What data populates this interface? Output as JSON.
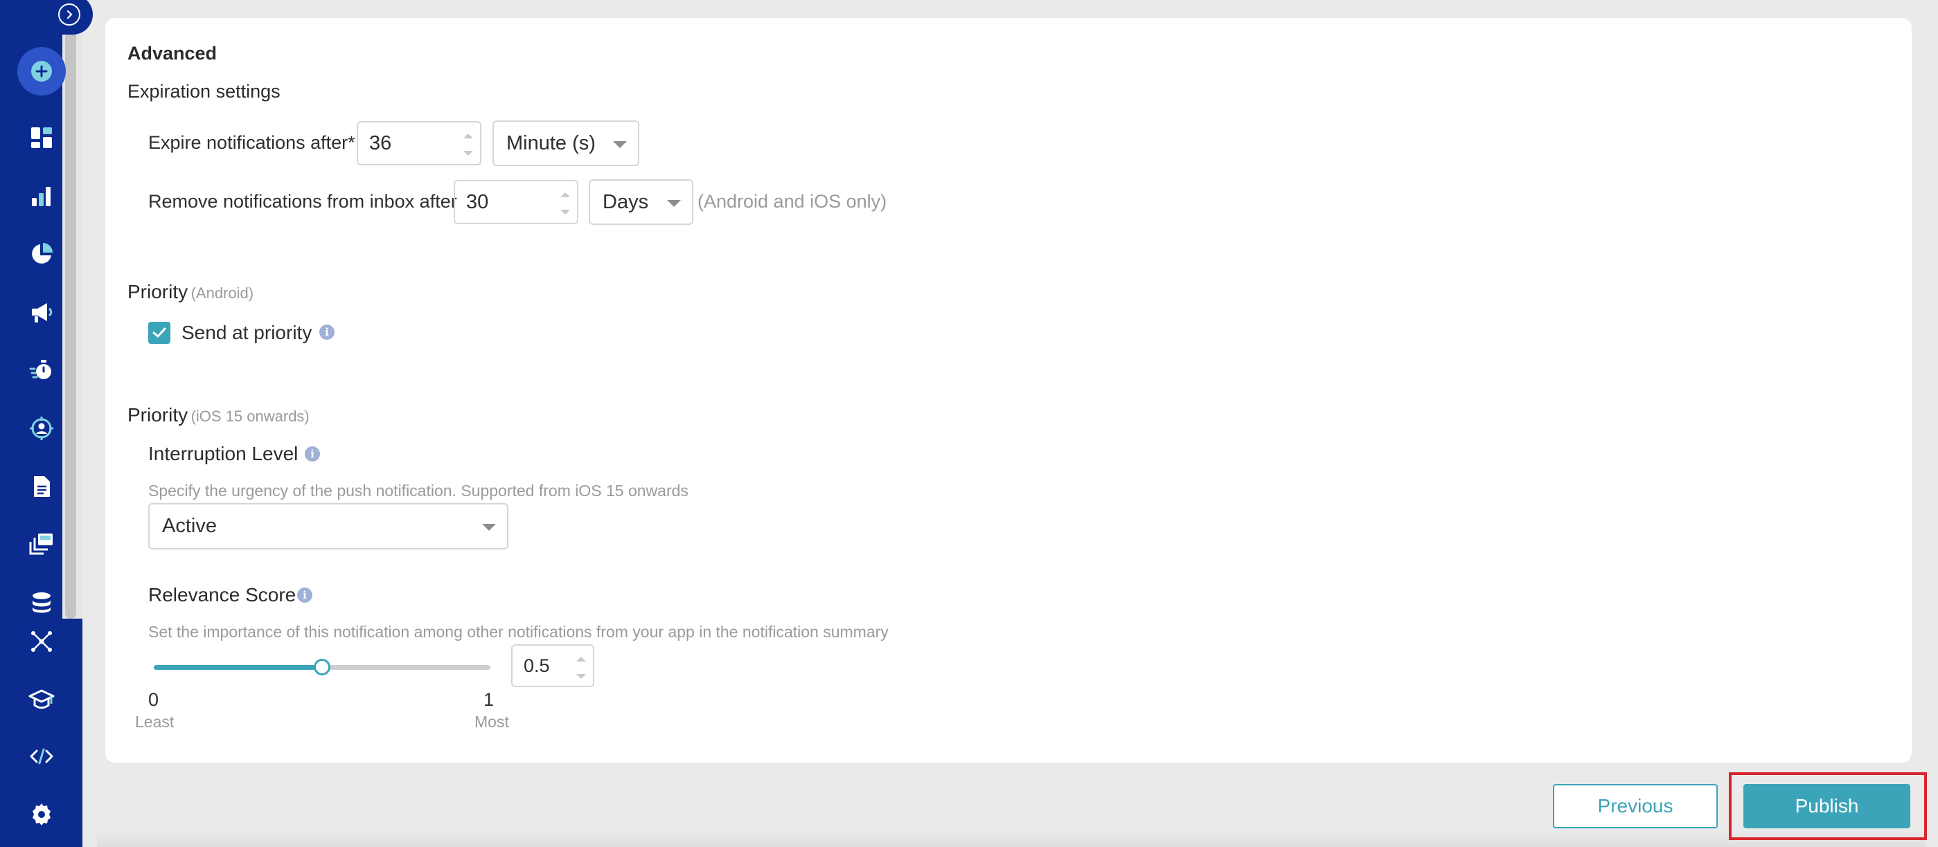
{
  "sidebar": {
    "items": [
      {
        "icon": "create-icon",
        "name": "create"
      },
      {
        "icon": "dashboard-icon",
        "name": "dashboard"
      },
      {
        "icon": "analytics-icon",
        "name": "analytics"
      },
      {
        "icon": "segments-icon",
        "name": "segments"
      },
      {
        "icon": "campaigns-icon",
        "name": "campaigns"
      },
      {
        "icon": "timer-icon",
        "name": "flows"
      },
      {
        "icon": "user-target-icon",
        "name": "user-profiles"
      },
      {
        "icon": "document-icon",
        "name": "content"
      },
      {
        "icon": "templates-icon",
        "name": "templates"
      },
      {
        "icon": "database-icon",
        "name": "data"
      },
      {
        "icon": "integrations-icon",
        "name": "integrations"
      },
      {
        "icon": "academy-icon",
        "name": "academy"
      },
      {
        "icon": "code-icon",
        "name": "developer"
      },
      {
        "icon": "settings-icon",
        "name": "settings"
      }
    ],
    "colors": {
      "background": "#0b2b8f",
      "icon": "#ffffff",
      "accent": "#7fd1e0"
    }
  },
  "advanced": {
    "title": "Advanced",
    "expiration": {
      "title": "Expiration settings",
      "expire_label": "Expire notifications after*",
      "expire_value": "36",
      "expire_unit": "Minute (s)",
      "remove_label": "Remove notifications from inbox after",
      "remove_value": "30",
      "remove_unit": "Days",
      "remove_note": "(Android and iOS only)"
    },
    "android_priority": {
      "title": "Priority",
      "qualifier": "(Android)",
      "checkbox_label": "Send at priority",
      "checked": true
    },
    "ios_priority": {
      "title": "Priority",
      "qualifier": "(iOS 15 onwards)",
      "interruption_title": "Interruption Level",
      "interruption_hint": "Specify the urgency of the push notification. Supported from iOS 15 onwards",
      "interruption_value": "Active",
      "relevance_title": "Relevance Score",
      "relevance_hint": "Set the importance of this notification among other notifications from your app in the notification summary",
      "relevance_value": "0.5",
      "relevance_fraction": 0.5,
      "min_value": "0",
      "min_label": "Least",
      "max_value": "1",
      "max_label": "Most"
    }
  },
  "footer": {
    "previous_label": "Previous",
    "publish_label": "Publish"
  },
  "colors": {
    "accent": "#3ba4b8",
    "highlight": "#d9262c",
    "info": "#9fb1d6"
  }
}
